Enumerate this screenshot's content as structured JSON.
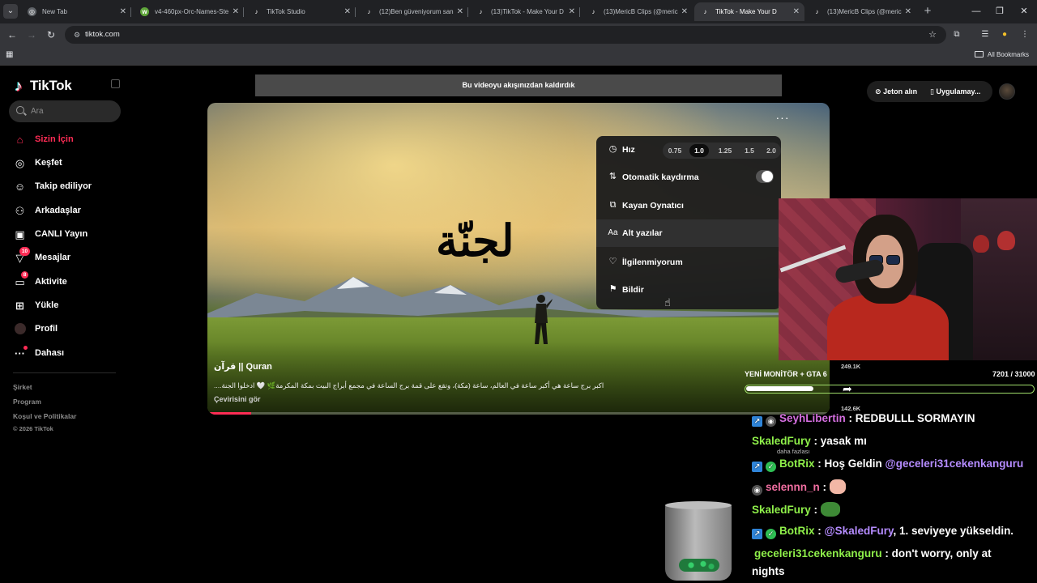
{
  "browser": {
    "tabs": [
      {
        "title": "New Tab",
        "active": false,
        "favicon": "chrome-icon"
      },
      {
        "title": "v4-460px-Orc-Names-Ste",
        "active": false,
        "favicon": "wikihow-icon"
      },
      {
        "title": "TikTok Studio",
        "active": false,
        "favicon": "tiktok-icon"
      },
      {
        "title": "(12)Ben güveniyorum san",
        "active": false,
        "favicon": "tiktok-icon"
      },
      {
        "title": "(13)TikTok - Make Your D",
        "active": false,
        "favicon": "tiktok-icon"
      },
      {
        "title": "(13)MericB Clips (@meric",
        "active": false,
        "favicon": "tiktok-icon"
      },
      {
        "title": "TikTok - Make Your D",
        "active": true,
        "favicon": "tiktok-icon"
      },
      {
        "title": "(13)MericB Clips (@meric",
        "active": false,
        "favicon": "tiktok-icon"
      }
    ],
    "url": "tiktok.com",
    "all_bookmarks": "All Bookmarks"
  },
  "sidebar": {
    "brand": "TikTok",
    "search_placeholder": "Ara",
    "items": [
      {
        "label": "Sizin İçin",
        "icon": "home-icon",
        "active": true
      },
      {
        "label": "Keşfet",
        "icon": "compass-icon"
      },
      {
        "label": "Takip ediliyor",
        "icon": "following-icon"
      },
      {
        "label": "Arkadaşlar",
        "icon": "friends-icon"
      },
      {
        "label": "CANLI Yayın",
        "icon": "live-icon"
      },
      {
        "label": "Mesajlar",
        "icon": "messages-icon",
        "badge": "10"
      },
      {
        "label": "Aktivite",
        "icon": "activity-icon",
        "badge": "8"
      },
      {
        "label": "Yükle",
        "icon": "upload-icon"
      },
      {
        "label": "Profil",
        "icon": "profile-icon"
      },
      {
        "label": "Dahası",
        "icon": "more-icon"
      }
    ],
    "footer": [
      "Şirket",
      "Program",
      "Koşul ve Politikalar"
    ],
    "copyright": "© 2026 TikTok"
  },
  "header": {
    "notice": "Bu videoyu akışınızdan kaldırdık",
    "coins": "Jeton alın",
    "app": "Uygulamay..."
  },
  "video": {
    "overlay_text": "لجنّة",
    "author": "قرآن || Quran",
    "description": "....اكبر برج ساعة هي أكبر ساعة في العالم، ساعة (مكة)، وتقع على قمة برج الساعة في مجمع أبراج البيت بمكة المكرمة🌿 🤍 ادخلوا الجنة",
    "translate": "Çevirisini gör",
    "progress": 0.07
  },
  "menu": {
    "speed_label": "Hız",
    "speeds": [
      "0.75",
      "1.0",
      "1.25",
      "1.5",
      "2.0"
    ],
    "selected_speed": "1.0",
    "autoscroll": "Otomatik kaydırma",
    "floating_player": "Kayan Oynatıcı",
    "captions": "Alt yazılar",
    "not_interested": "İlgilenmiyorum",
    "report": "Bildir"
  },
  "stream": {
    "goal_title": "YENİ MONİTÖR + GTA 6",
    "goal_count": "7201 / 31000",
    "goal_progress": 0.232,
    "stat_top": "249.1K",
    "stat_bottom": "142.6K",
    "more_label": "daha fazlası",
    "chat": [
      {
        "user": "SeyhLibertin",
        "text": ": REDBULLL SORMAYIN"
      },
      {
        "user": "SkaledFury",
        "text": ": yasak mı"
      },
      {
        "user": "BotRix",
        "text": ": Hoş Geldin ",
        "mention": "@geceleri31cekenkanguru"
      },
      {
        "user": "selennn_n",
        "text": ":"
      },
      {
        "user": "SkaledFury",
        "text": ":"
      },
      {
        "user": "BotRix",
        "text": ", 1. seviyeye yükseldin.",
        "pre": ": ",
        "mention": "@SkaledFury"
      },
      {
        "user": "geceleri31cekenkanguru",
        "text": ": don't worry, only at"
      },
      {
        "text": "nights"
      }
    ]
  }
}
